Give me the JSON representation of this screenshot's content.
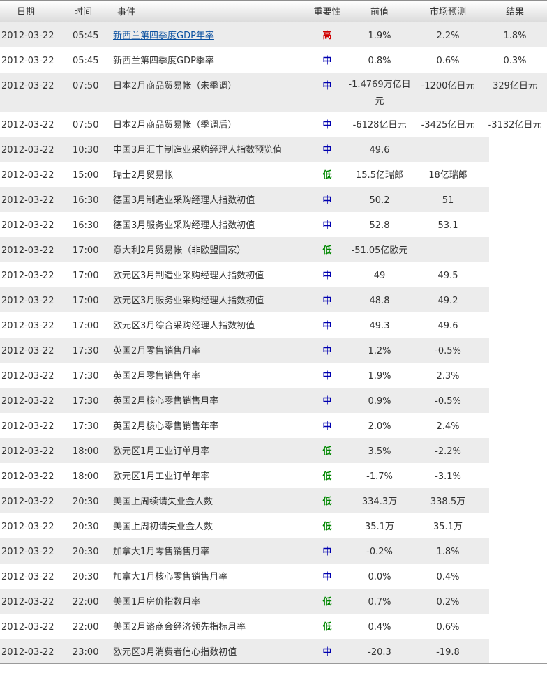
{
  "header": {
    "date": "日期",
    "time": "时间",
    "event": "事件",
    "importance": "重要性",
    "previous": "前值",
    "forecast": "市场预测",
    "actual": "结果"
  },
  "colors": {
    "high": "#d00000",
    "medium": "#0000b0",
    "low": "#008800",
    "link": "#0a50a0"
  },
  "rows": [
    {
      "date": "2012-03-22",
      "time": "05:45",
      "event": "新西兰第四季度GDP年率",
      "importance": "高",
      "previous": "1.9%",
      "forecast": "2.2%",
      "actual": "1.8%",
      "link": true
    },
    {
      "date": "2012-03-22",
      "time": "05:45",
      "event": "新西兰第四季度GDP季率",
      "importance": "中",
      "previous": "0.8%",
      "forecast": "0.6%",
      "actual": "0.3%"
    },
    {
      "date": "2012-03-22",
      "time": "07:50",
      "event": "日本2月商品贸易帐（未季调）",
      "importance": "中",
      "previous": "-1.4769万亿日元",
      "forecast": "-1200亿日元",
      "actual": "329亿日元"
    },
    {
      "date": "2012-03-22",
      "time": "07:50",
      "event": "日本2月商品贸易帐（季调后）",
      "importance": "中",
      "previous": "-6128亿日元",
      "forecast": "-3425亿日元",
      "actual": "-3132亿日元"
    },
    {
      "date": "2012-03-22",
      "time": "10:30",
      "event": "中国3月汇丰制造业采购经理人指数预览值",
      "importance": "中",
      "previous": "49.6",
      "forecast": "",
      "actual": ""
    },
    {
      "date": "2012-03-22",
      "time": "15:00",
      "event": "瑞士2月贸易帐",
      "importance": "低",
      "previous": "15.5亿瑞郎",
      "forecast": "18亿瑞郎",
      "actual": ""
    },
    {
      "date": "2012-03-22",
      "time": "16:30",
      "event": "德国3月制造业采购经理人指数初值",
      "importance": "中",
      "previous": "50.2",
      "forecast": "51",
      "actual": ""
    },
    {
      "date": "2012-03-22",
      "time": "16:30",
      "event": "德国3月服务业采购经理人指数初值",
      "importance": "中",
      "previous": "52.8",
      "forecast": "53.1",
      "actual": ""
    },
    {
      "date": "2012-03-22",
      "time": "17:00",
      "event": "意大利2月贸易帐（非欧盟国家）",
      "importance": "低",
      "previous": "-51.05亿欧元",
      "forecast": "",
      "actual": ""
    },
    {
      "date": "2012-03-22",
      "time": "17:00",
      "event": "欧元区3月制造业采购经理人指数初值",
      "importance": "中",
      "previous": "49",
      "forecast": "49.5",
      "actual": ""
    },
    {
      "date": "2012-03-22",
      "time": "17:00",
      "event": "欧元区3月服务业采购经理人指数初值",
      "importance": "中",
      "previous": "48.8",
      "forecast": "49.2",
      "actual": ""
    },
    {
      "date": "2012-03-22",
      "time": "17:00",
      "event": "欧元区3月综合采购经理人指数初值",
      "importance": "中",
      "previous": "49.3",
      "forecast": "49.6",
      "actual": ""
    },
    {
      "date": "2012-03-22",
      "time": "17:30",
      "event": "英国2月零售销售月率",
      "importance": "中",
      "previous": "1.2%",
      "forecast": "-0.5%",
      "actual": ""
    },
    {
      "date": "2012-03-22",
      "time": "17:30",
      "event": "英国2月零售销售年率",
      "importance": "中",
      "previous": "1.9%",
      "forecast": "2.3%",
      "actual": ""
    },
    {
      "date": "2012-03-22",
      "time": "17:30",
      "event": "英国2月核心零售销售月率",
      "importance": "中",
      "previous": "0.9%",
      "forecast": "-0.5%",
      "actual": ""
    },
    {
      "date": "2012-03-22",
      "time": "17:30",
      "event": "英国2月核心零售销售年率",
      "importance": "中",
      "previous": "2.0%",
      "forecast": "2.4%",
      "actual": ""
    },
    {
      "date": "2012-03-22",
      "time": "18:00",
      "event": "欧元区1月工业订单月率",
      "importance": "低",
      "previous": "3.5%",
      "forecast": "-2.2%",
      "actual": ""
    },
    {
      "date": "2012-03-22",
      "time": "18:00",
      "event": "欧元区1月工业订单年率",
      "importance": "低",
      "previous": "-1.7%",
      "forecast": "-3.1%",
      "actual": ""
    },
    {
      "date": "2012-03-22",
      "time": "20:30",
      "event": "美国上周续请失业金人数",
      "importance": "低",
      "previous": "334.3万",
      "forecast": "338.5万",
      "actual": ""
    },
    {
      "date": "2012-03-22",
      "time": "20:30",
      "event": "美国上周初请失业金人数",
      "importance": "低",
      "previous": "35.1万",
      "forecast": "35.1万",
      "actual": ""
    },
    {
      "date": "2012-03-22",
      "time": "20:30",
      "event": "加拿大1月零售销售月率",
      "importance": "中",
      "previous": "-0.2%",
      "forecast": "1.8%",
      "actual": ""
    },
    {
      "date": "2012-03-22",
      "time": "20:30",
      "event": "加拿大1月核心零售销售月率",
      "importance": "中",
      "previous": "0.0%",
      "forecast": "0.4%",
      "actual": ""
    },
    {
      "date": "2012-03-22",
      "time": "22:00",
      "event": "美国1月房价指数月率",
      "importance": "低",
      "previous": "0.7%",
      "forecast": "0.2%",
      "actual": ""
    },
    {
      "date": "2012-03-22",
      "time": "22:00",
      "event": "美国2月谘商会经济领先指标月率",
      "importance": "低",
      "previous": "0.4%",
      "forecast": "0.6%",
      "actual": ""
    },
    {
      "date": "2012-03-22",
      "time": "23:00",
      "event": "欧元区3月消费者信心指数初值",
      "importance": "中",
      "previous": "-20.3",
      "forecast": "-19.8",
      "actual": ""
    }
  ]
}
